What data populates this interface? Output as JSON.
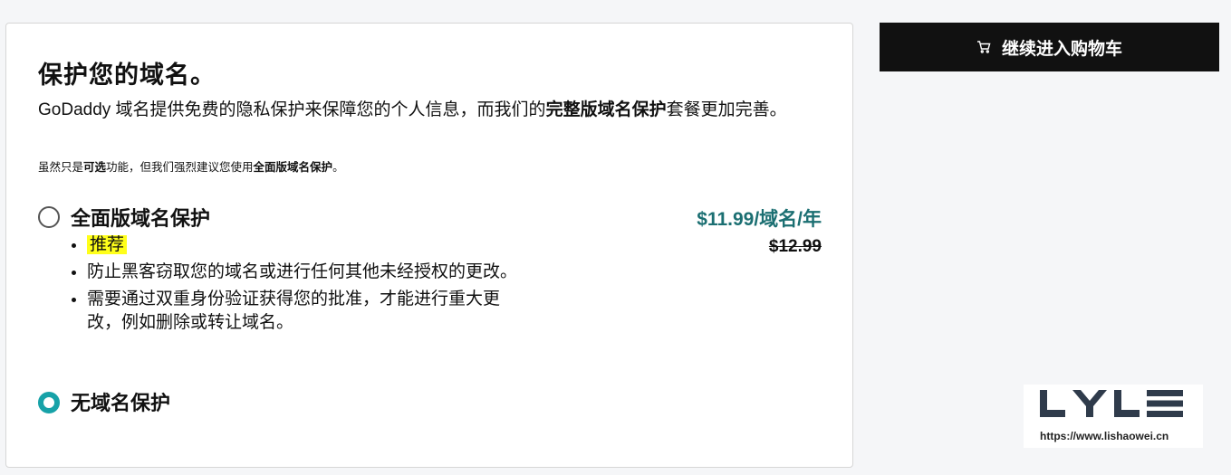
{
  "protection": {
    "title": "保护您的域名。",
    "desc_prefix": "GoDaddy 域名提供免费的隐私保护来保障您的个人信息，而我们的",
    "desc_bold": "完整版域名保护",
    "desc_suffix": "套餐更加完善。",
    "note_prefix": "虽然只是",
    "note_bold_optional": "可选",
    "note_middle": "功能，但我们强烈建议您使用",
    "note_bold_full": "全面版域名保护",
    "note_suffix": "。"
  },
  "options": [
    {
      "label": "全面版域名保护",
      "selected": false,
      "price": "$11.99/域名/年",
      "original_price": "$12.99",
      "features": [
        "推荐",
        "防止黑客窃取您的域名或进行任何其他未经授权的更改。",
        "需要通过双重身份验证获得您的批准，才能进行重大更改，例如删除或转让域名。"
      ]
    },
    {
      "label": "无域名保护",
      "selected": true
    }
  ],
  "cart_button": {
    "label": "继续进入购物车",
    "icon": "cart-icon"
  },
  "watermark": {
    "logo_text": "LYLE",
    "url": "https://www.lishaowei.cn"
  },
  "colors": {
    "accent": "#17a2a8",
    "price": "#1b6f72",
    "highlight": "#ffff1a",
    "button_bg": "#111111"
  }
}
